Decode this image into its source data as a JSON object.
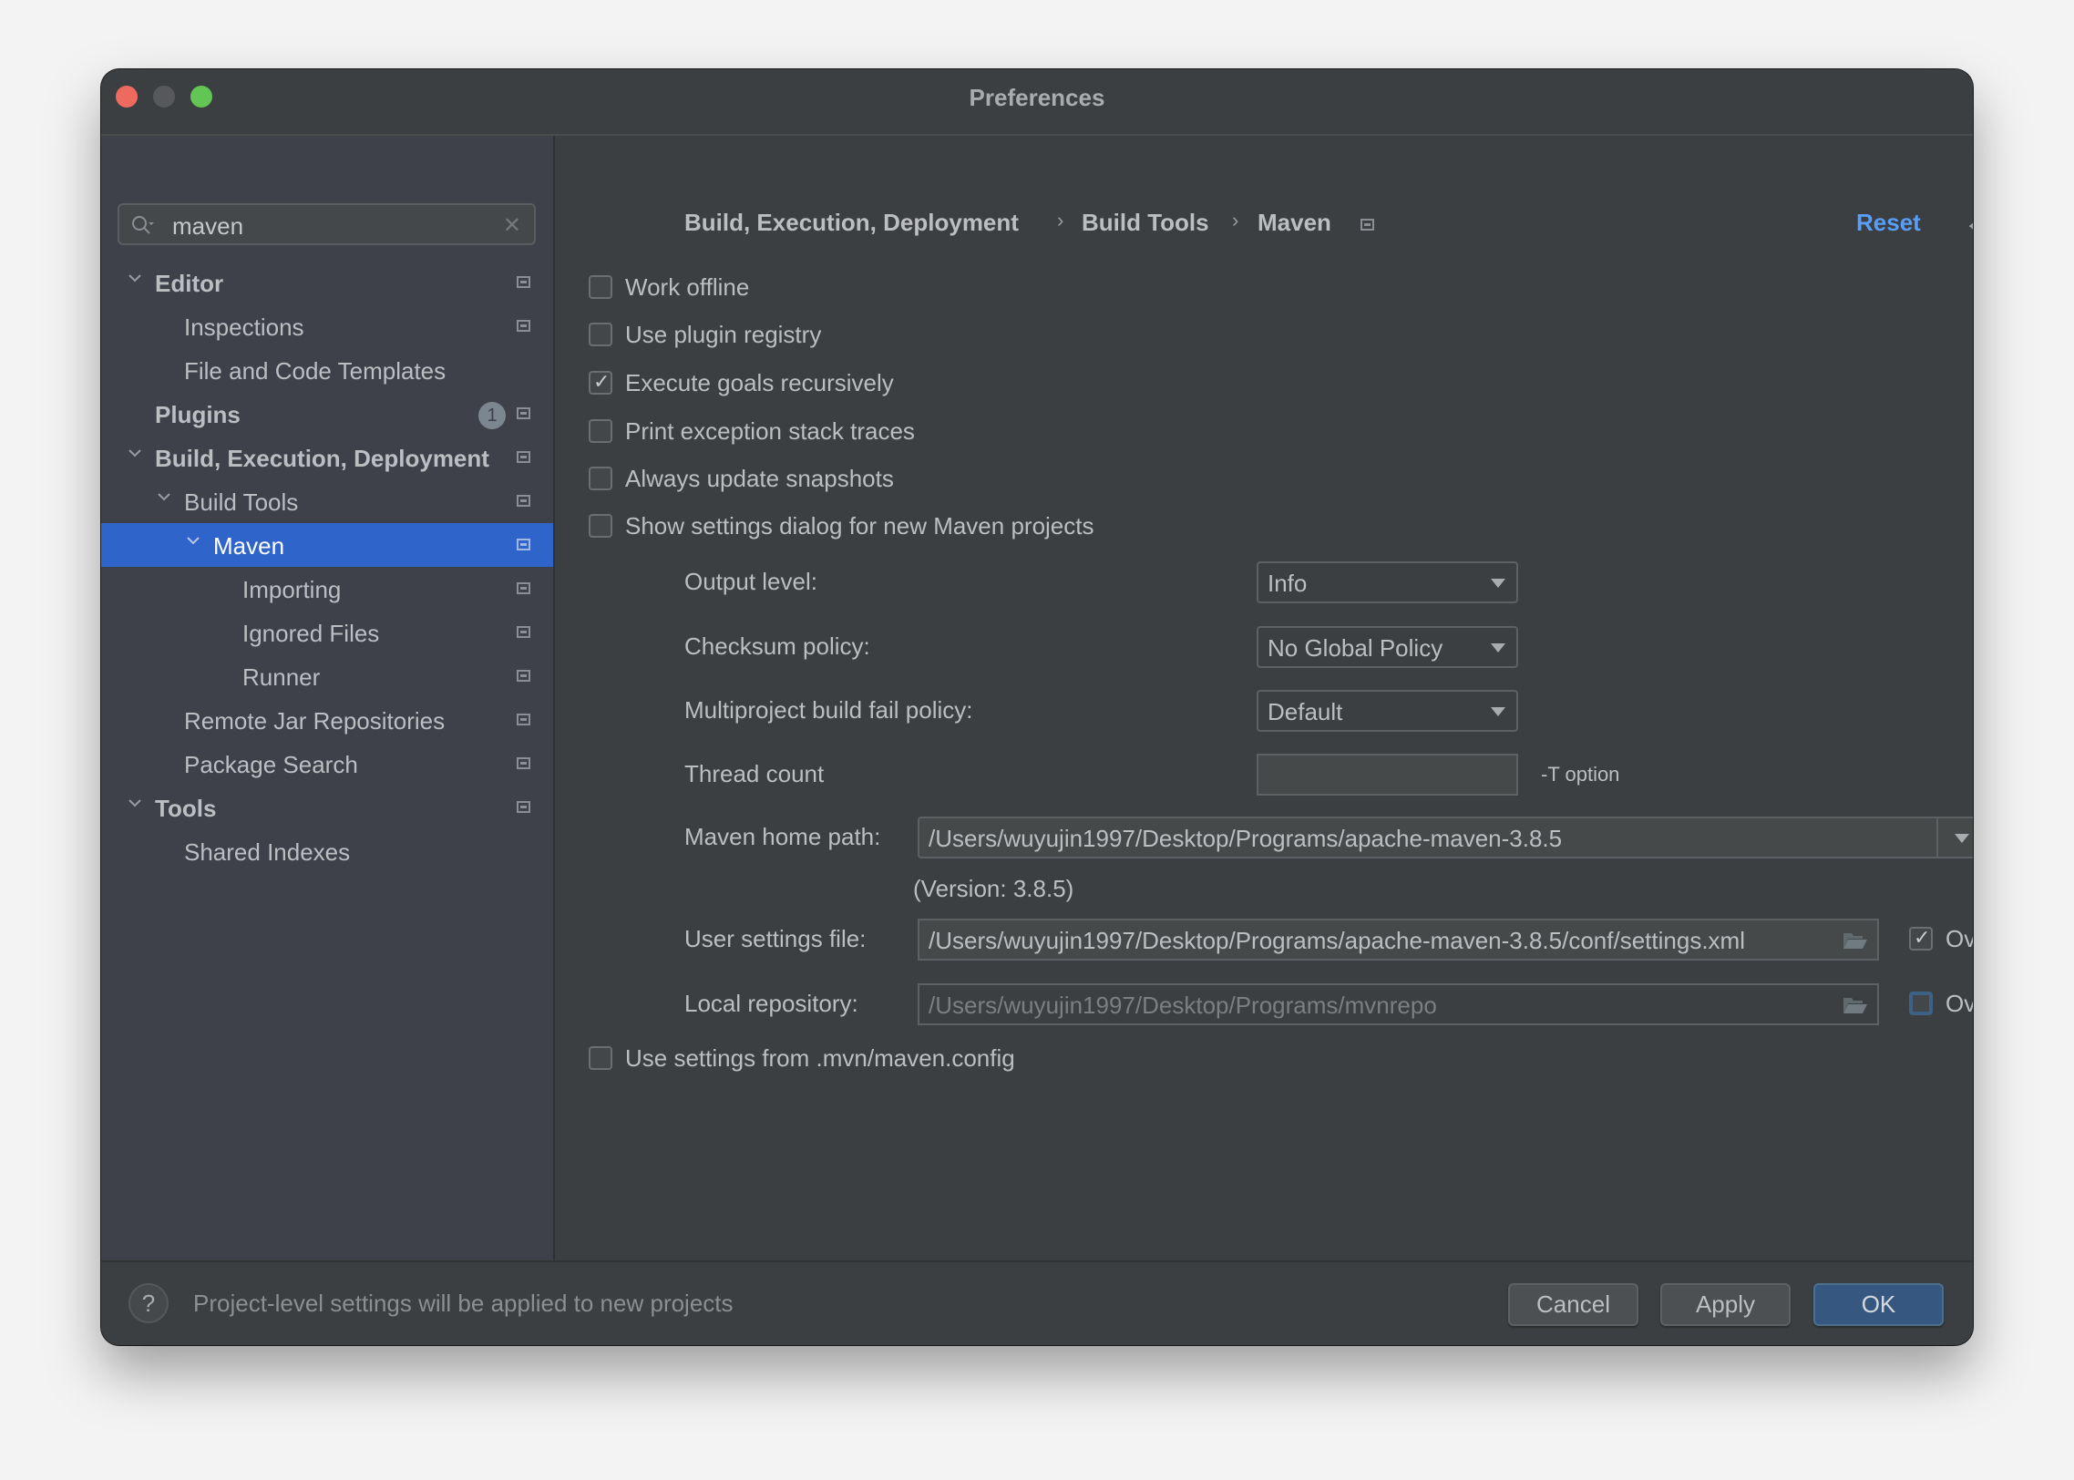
{
  "window": {
    "title": "Preferences"
  },
  "sidebar": {
    "search": {
      "value": "maven"
    },
    "items": [
      {
        "label": "Editor",
        "level": 0,
        "bold": true,
        "expanded": true
      },
      {
        "label": "Inspections",
        "level": 1
      },
      {
        "label": "File and Code Templates",
        "level": 1
      },
      {
        "label": "Plugins",
        "level": 0,
        "bold": true,
        "badge": "1"
      },
      {
        "label": "Build, Execution, Deployment",
        "level": 0,
        "bold": true,
        "expanded": true
      },
      {
        "label": "Build Tools",
        "level": 1,
        "expanded": true
      },
      {
        "label": "Maven",
        "level": 2,
        "expanded": true,
        "selected": true
      },
      {
        "label": "Importing",
        "level": 3
      },
      {
        "label": "Ignored Files",
        "level": 3
      },
      {
        "label": "Runner",
        "level": 3
      },
      {
        "label": "Remote Jar Repositories",
        "level": 1
      },
      {
        "label": "Package Search",
        "level": 1
      },
      {
        "label": "Tools",
        "level": 0,
        "bold": true,
        "expanded": true
      },
      {
        "label": "Shared Indexes",
        "level": 1
      }
    ]
  },
  "header": {
    "breadcrumb": [
      "Build, Execution, Deployment",
      "Build Tools",
      "Maven"
    ],
    "separator": "›",
    "reset_label": "Reset",
    "back_icon": "←",
    "forward_icon": "→"
  },
  "options": [
    {
      "label": "Work offline",
      "checked": false
    },
    {
      "label": "Use plugin registry",
      "checked": false
    },
    {
      "label": "Execute goals recursively",
      "checked": true
    },
    {
      "label": "Print exception stack traces",
      "checked": false
    },
    {
      "label": "Always update snapshots",
      "checked": false
    },
    {
      "label": "Show settings dialog for new Maven projects",
      "checked": false
    }
  ],
  "fields": {
    "output_level": {
      "label": "Output level:",
      "value": "Info"
    },
    "checksum_policy": {
      "label": "Checksum policy:",
      "value": "No Global Policy"
    },
    "fail_policy": {
      "label": "Multiproject build fail policy:",
      "value": "Default"
    },
    "thread_count": {
      "label": "Thread count",
      "value": "",
      "hint": "-T option"
    },
    "maven_home": {
      "label": "Maven home path:",
      "value": "/Users/wuyujin1997/Desktop/Programs/apache-maven-3.8.5",
      "browse_label": "...",
      "version": "(Version: 3.8.5)"
    },
    "user_settings": {
      "label": "User settings file:",
      "value": "/Users/wuyujin1997/Desktop/Programs/apache-maven-3.8.5/conf/settings.xml",
      "override_label": "Override",
      "override": true
    },
    "local_repo": {
      "label": "Local repository:",
      "value": "/Users/wuyujin1997/Desktop/Programs/mvnrepo",
      "override_label": "Override",
      "override": false
    },
    "use_mvn_config": {
      "label": "Use settings from .mvn/maven.config",
      "checked": false
    }
  },
  "footer": {
    "help_icon": "?",
    "message": "Project-level settings will be applied to new projects",
    "cancel_label": "Cancel",
    "apply_label": "Apply",
    "ok_label": "OK"
  },
  "colors": {
    "selection": "#2f65ca",
    "link": "#589df6",
    "primary_button": "#365880"
  }
}
